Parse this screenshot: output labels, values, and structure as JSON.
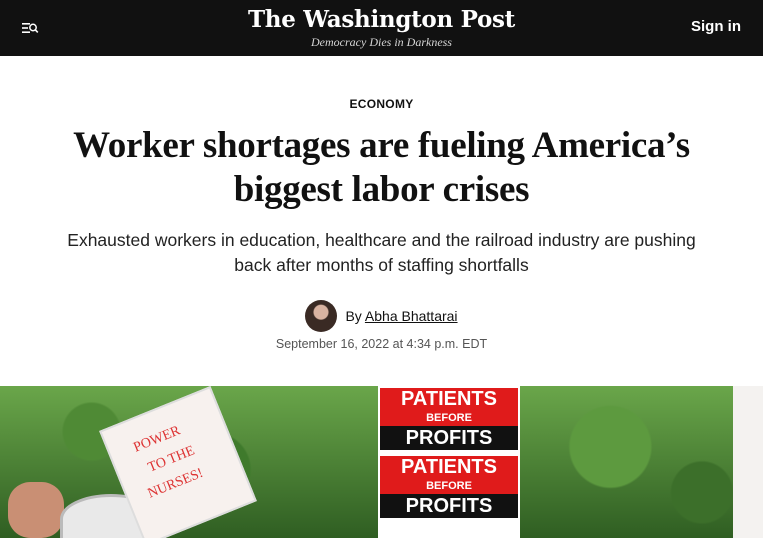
{
  "header": {
    "logo": "The Washington Post",
    "tagline": "Democracy Dies in Darkness",
    "signin_label": "Sign in",
    "menu_icon": "menu-search-icon"
  },
  "article": {
    "section": "ECONOMY",
    "headline": "Worker shortages are fueling America’s biggest labor crises",
    "dek": "Exhausted workers in education, healthcare and the railroad industry are pushing back after months of staffing shortfalls",
    "byline_prefix": "By",
    "author": "Abha Bhattarai",
    "date": "September 16, 2022 at 4:34 p.m. EDT"
  },
  "photo": {
    "sign_center": [
      "PATIENTS",
      "BEFORE",
      "PROFITS",
      "PATIENTS",
      "BEFORE",
      "PROFITS"
    ],
    "sign_left": [
      "POWER",
      "TO THE",
      "NURSES!"
    ]
  }
}
